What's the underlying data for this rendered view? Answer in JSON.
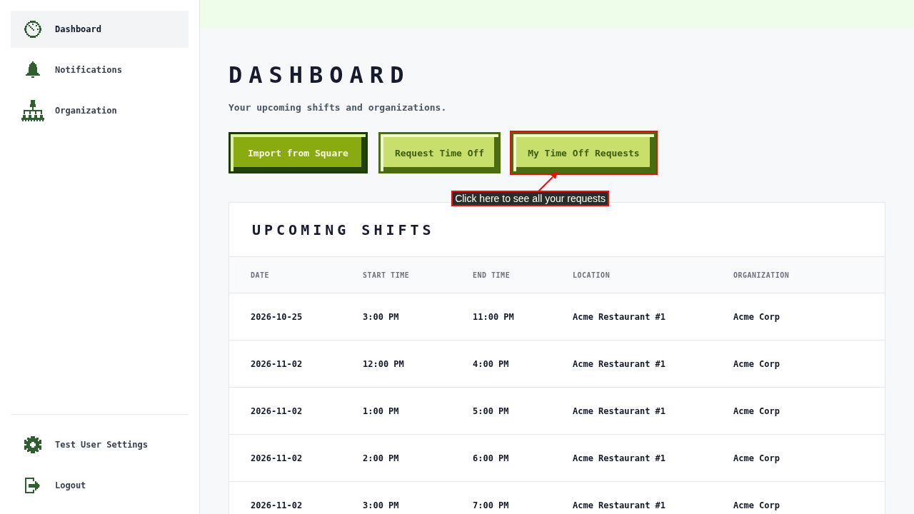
{
  "sidebar": {
    "nav": [
      {
        "label": "Dashboard",
        "selected": true
      },
      {
        "label": "Notifications",
        "selected": false
      },
      {
        "label": "Organization",
        "selected": false
      }
    ],
    "footer": [
      {
        "label": "Test User Settings",
        "selected": false
      },
      {
        "label": "Logout",
        "selected": false
      }
    ]
  },
  "page": {
    "title": "DASHBOARD",
    "subtitle": "Your upcoming shifts and organizations."
  },
  "actions": [
    {
      "label": "Import from Square",
      "kind": "primary",
      "highlighted": false
    },
    {
      "label": "Request Time Off",
      "kind": "secondary",
      "highlighted": false
    },
    {
      "label": "My Time Off Requests",
      "kind": "secondary",
      "highlighted": true,
      "callout": "Click here to see all your requests"
    }
  ],
  "shifts": {
    "title": "UPCOMING SHIFTS",
    "columns": [
      "DATE",
      "START TIME",
      "END TIME",
      "LOCATION",
      "ORGANIZATION"
    ],
    "rows": [
      [
        "2026-10-25",
        "3:00 PM",
        "11:00 PM",
        "Acme Restaurant #1",
        "Acme Corp"
      ],
      [
        "2026-11-02",
        "12:00 PM",
        "4:00 PM",
        "Acme Restaurant #1",
        "Acme Corp"
      ],
      [
        "2026-11-02",
        "1:00 PM",
        "5:00 PM",
        "Acme Restaurant #1",
        "Acme Corp"
      ],
      [
        "2026-11-02",
        "2:00 PM",
        "6:00 PM",
        "Acme Restaurant #1",
        "Acme Corp"
      ],
      [
        "2026-11-02",
        "3:00 PM",
        "7:00 PM",
        "Acme Restaurant #1",
        "Acme Corp"
      ]
    ]
  }
}
